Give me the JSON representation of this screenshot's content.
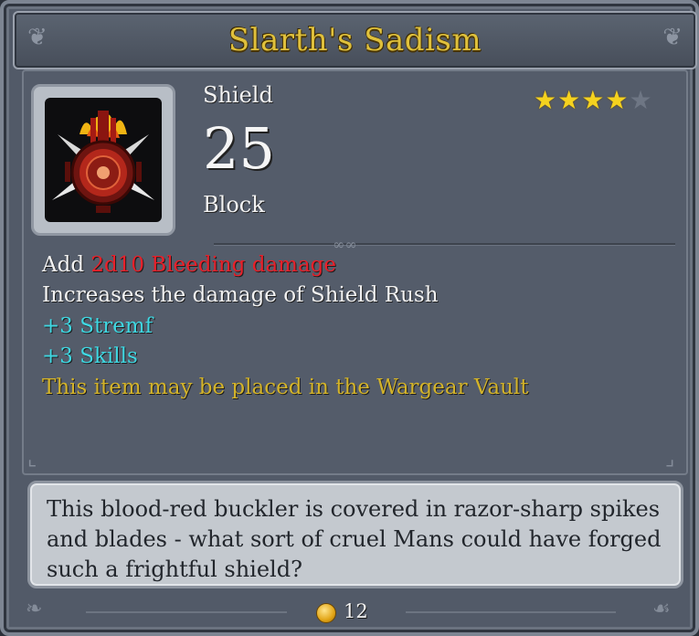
{
  "item": {
    "title": "Slarth's Sadism",
    "type": "Shield",
    "block_value": "25",
    "block_label": "Block",
    "rating": {
      "value": 4,
      "max": 5
    },
    "icon": "spiked-red-shield-icon"
  },
  "stats": {
    "line1_prefix": "Add",
    "line1_highlight": "2d10 Bleeding damage",
    "line2": "Increases the damage of Shield Rush",
    "line3": "+3 Stremf",
    "line4": "+3 Skills",
    "line5": "This item may be placed in the Wargear Vault"
  },
  "description": "This blood-red buckler is covered in razor-sharp spikes and blades - what sort of cruel Mans could have forged such a frightful shield?",
  "footer": {
    "price": "12",
    "currency_icon": "gold-coin-icon"
  },
  "colors": {
    "title": "#e0c13c",
    "bleeding": "#e8202a",
    "bonus": "#3fd7e2",
    "vault_note": "#d3b32a",
    "star_on": "#f5d21f",
    "star_off": "#6e7684"
  }
}
